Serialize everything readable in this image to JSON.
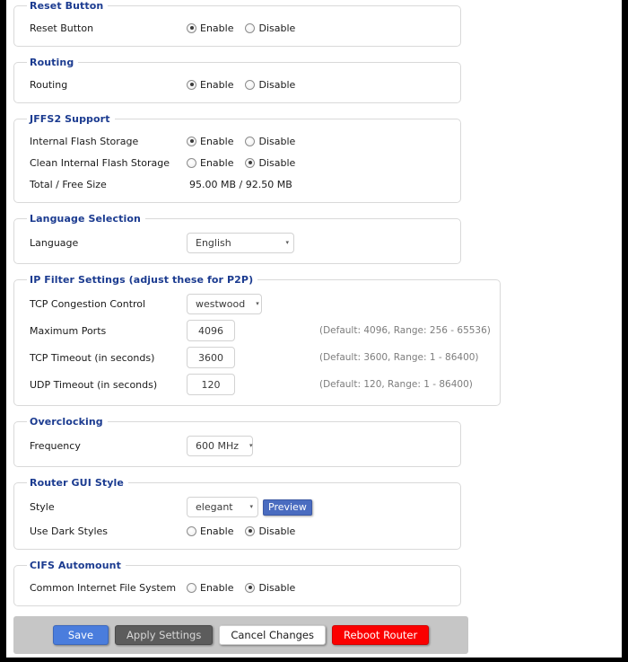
{
  "options": {
    "enable": "Enable",
    "disable": "Disable"
  },
  "sections": {
    "reset_button": {
      "legend": "Reset Button",
      "row_label": "Reset Button",
      "selected": "Enable"
    },
    "routing": {
      "legend": "Routing",
      "row_label": "Routing",
      "selected": "Enable"
    },
    "jffs2": {
      "legend": "JFFS2 Support",
      "internal_flash_label": "Internal Flash Storage",
      "internal_flash_selected": "Enable",
      "clean_flash_label": "Clean Internal Flash Storage",
      "clean_flash_selected": "Disable",
      "size_label": "Total / Free Size",
      "size_value": "95.00 MB / 92.50 MB"
    },
    "language": {
      "legend": "Language Selection",
      "row_label": "Language",
      "value": "English"
    },
    "ip_filter": {
      "legend": "IP Filter Settings (adjust these for P2P)",
      "tcp_congestion_label": "TCP Congestion Control",
      "tcp_congestion_value": "westwood",
      "max_ports_label": "Maximum Ports",
      "max_ports_value": "4096",
      "max_ports_hint": "(Default: 4096, Range: 256 - 65536)",
      "tcp_timeout_label": "TCP Timeout (in seconds)",
      "tcp_timeout_value": "3600",
      "tcp_timeout_hint": "(Default: 3600, Range: 1 - 86400)",
      "udp_timeout_label": "UDP Timeout (in seconds)",
      "udp_timeout_value": "120",
      "udp_timeout_hint": "(Default: 120, Range: 1 - 86400)"
    },
    "overclocking": {
      "legend": "Overclocking",
      "row_label": "Frequency",
      "value": "600 MHz"
    },
    "gui_style": {
      "legend": "Router GUI Style",
      "style_label": "Style",
      "style_value": "elegant",
      "preview_label": "Preview",
      "dark_label": "Use Dark Styles",
      "dark_selected": "Disable"
    },
    "cifs": {
      "legend": "CIFS Automount",
      "row_label": "Common Internet File System",
      "selected": "Disable"
    }
  },
  "footer": {
    "save": "Save",
    "apply": "Apply Settings",
    "cancel": "Cancel Changes",
    "reboot": "Reboot Router"
  },
  "colors": {
    "legend": "#1b3b90",
    "accent_blue": "#4a7ddd",
    "danger_red": "#fb0000",
    "footer_bg": "#c6c6c6"
  },
  "icons": {
    "caret": "▾"
  }
}
